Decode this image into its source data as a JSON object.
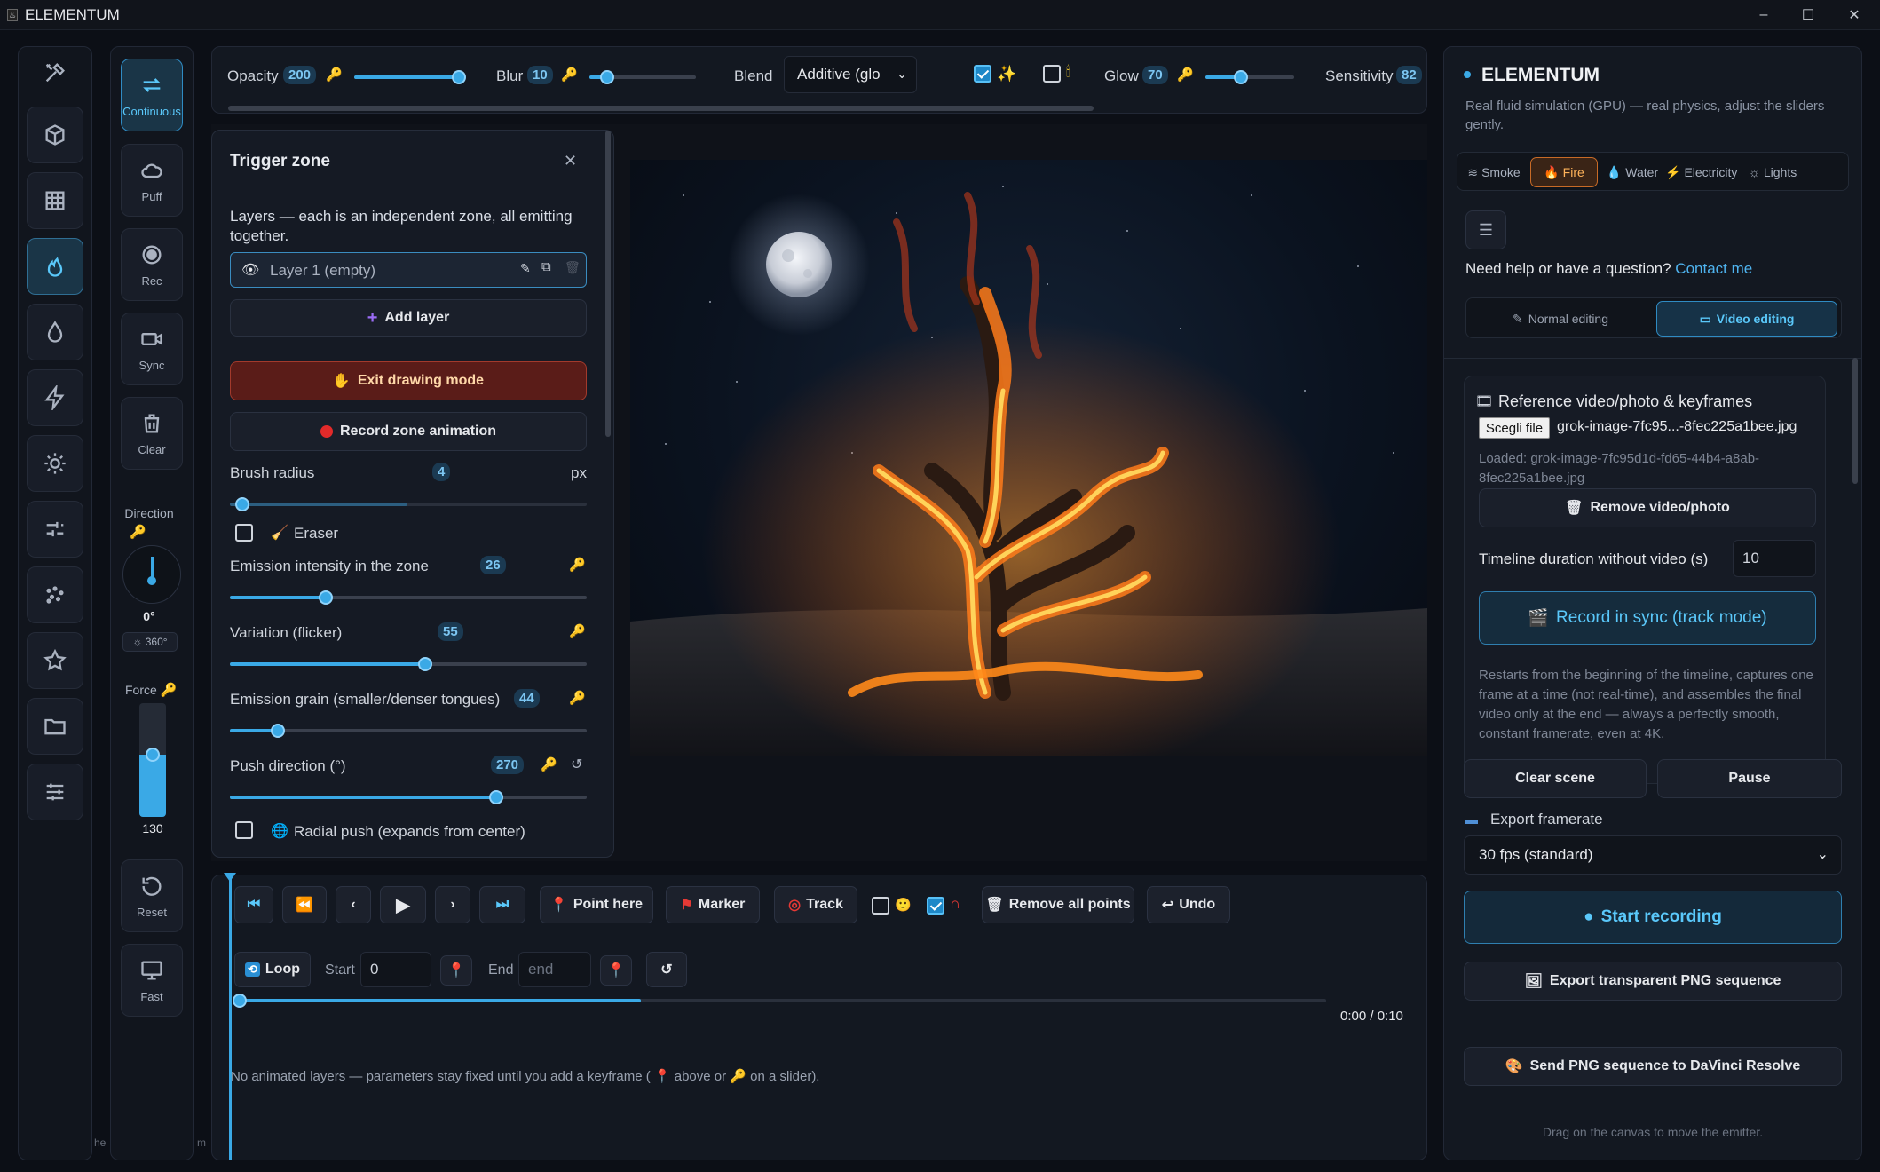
{
  "window": {
    "title": "ELEMENTUM",
    "minimize": "–",
    "maximize": "☐",
    "close": "✕"
  },
  "rail": [
    "tools-icon",
    "cube-icon",
    "grid-icon",
    "fire-icon",
    "water-drop-icon",
    "lightning-icon",
    "sun-icon",
    "sliders-icon",
    "particles-icon",
    "star-icon",
    "folder-icon",
    "adjust-icon"
  ],
  "tools": {
    "continuous": "Continuous",
    "puff": "Puff",
    "rec": "Rec",
    "sync": "Sync",
    "clear": "Clear",
    "direction_label": "Direction",
    "direction_value": "0°",
    "direction_360": "☼ 360°",
    "force_label": "Force",
    "force_value": "130",
    "force_level": 0.55,
    "reset": "Reset",
    "fast": "Fast"
  },
  "topbar": {
    "opacity_label": "Opacity",
    "opacity_value": "200",
    "blur_label": "Blur",
    "blur_value": "10",
    "blend_label": "Blend",
    "blend_value": "Additive (glo",
    "glow_label": "Glow",
    "glow_value": "70",
    "sensitivity_label": "Sensitivity",
    "sensitivity_value": "82"
  },
  "trigger": {
    "title": "Trigger zone",
    "desc": "Layers — each is an independent zone, all emitting together.",
    "layer_name": "Layer 1 (empty)",
    "add_layer": "Add layer",
    "exit_drawing": "Exit drawing mode",
    "record_zone": "Record zone animation",
    "brush_label": "Brush radius",
    "brush_value": "4",
    "brush_unit": "px",
    "eraser": "Eraser",
    "emission_label": "Emission intensity in the zone",
    "emission_value": "26",
    "variation_label": "Variation (flicker)",
    "variation_value": "55",
    "grain_label": "Emission grain (smaller/denser tongues)",
    "grain_value": "44",
    "push_label": "Push direction (°)",
    "push_value": "270",
    "radial_label": "Radial push (expands from center)"
  },
  "timeline": {
    "point_here": "Point here",
    "marker": "Marker",
    "track": "Track",
    "remove_all": "Remove all points",
    "undo": "Undo",
    "loop": "Loop",
    "start_label": "Start",
    "start_value": "0",
    "end_label": "End",
    "end_placeholder": "end",
    "time": "0:00 / 0:10",
    "progress": 0.5,
    "hint": "No animated layers — parameters stay fixed until you add a keyframe ( 📍 above or 🔑 on a slider)."
  },
  "right": {
    "title": "ELEMENTUM",
    "subtitle": "Real fluid simulation (GPU) — real physics, adjust the sliders gently.",
    "tabs": [
      "Smoke",
      "Fire",
      "Water",
      "Electricity",
      "Lights"
    ],
    "help_text": "Need help or have a question?",
    "contact": "Contact me",
    "normal_editing": "Normal editing",
    "video_editing": "Video editing",
    "ref_title": "Reference video/photo & keyframes",
    "choose_file": "Scegli file",
    "file_name": "grok-image-7fc95...-8fec225a1bee.jpg",
    "loaded": "Loaded: grok-image-7fc95d1d-fd65-44b4-a8ab-8fec225a1bee.jpg",
    "remove_media": "Remove video/photo",
    "duration_label": "Timeline duration without video (s)",
    "duration_value": "10",
    "record_sync": "Record in sync (track mode)",
    "record_desc": "Restarts from the beginning of the timeline, captures one frame at a time (not real-time), and assembles the final video only at the end — always a perfectly smooth, constant framerate, even at 4K.",
    "clear_scene": "Clear scene",
    "pause": "Pause",
    "export_label": "Export framerate",
    "framerate": "30 fps (standard)",
    "start_recording": "Start recording",
    "export_png": "Export transparent PNG sequence",
    "send_davinci": "Send PNG sequence to DaVinci Resolve",
    "footer": "Drag on the canvas to move the emitter."
  }
}
